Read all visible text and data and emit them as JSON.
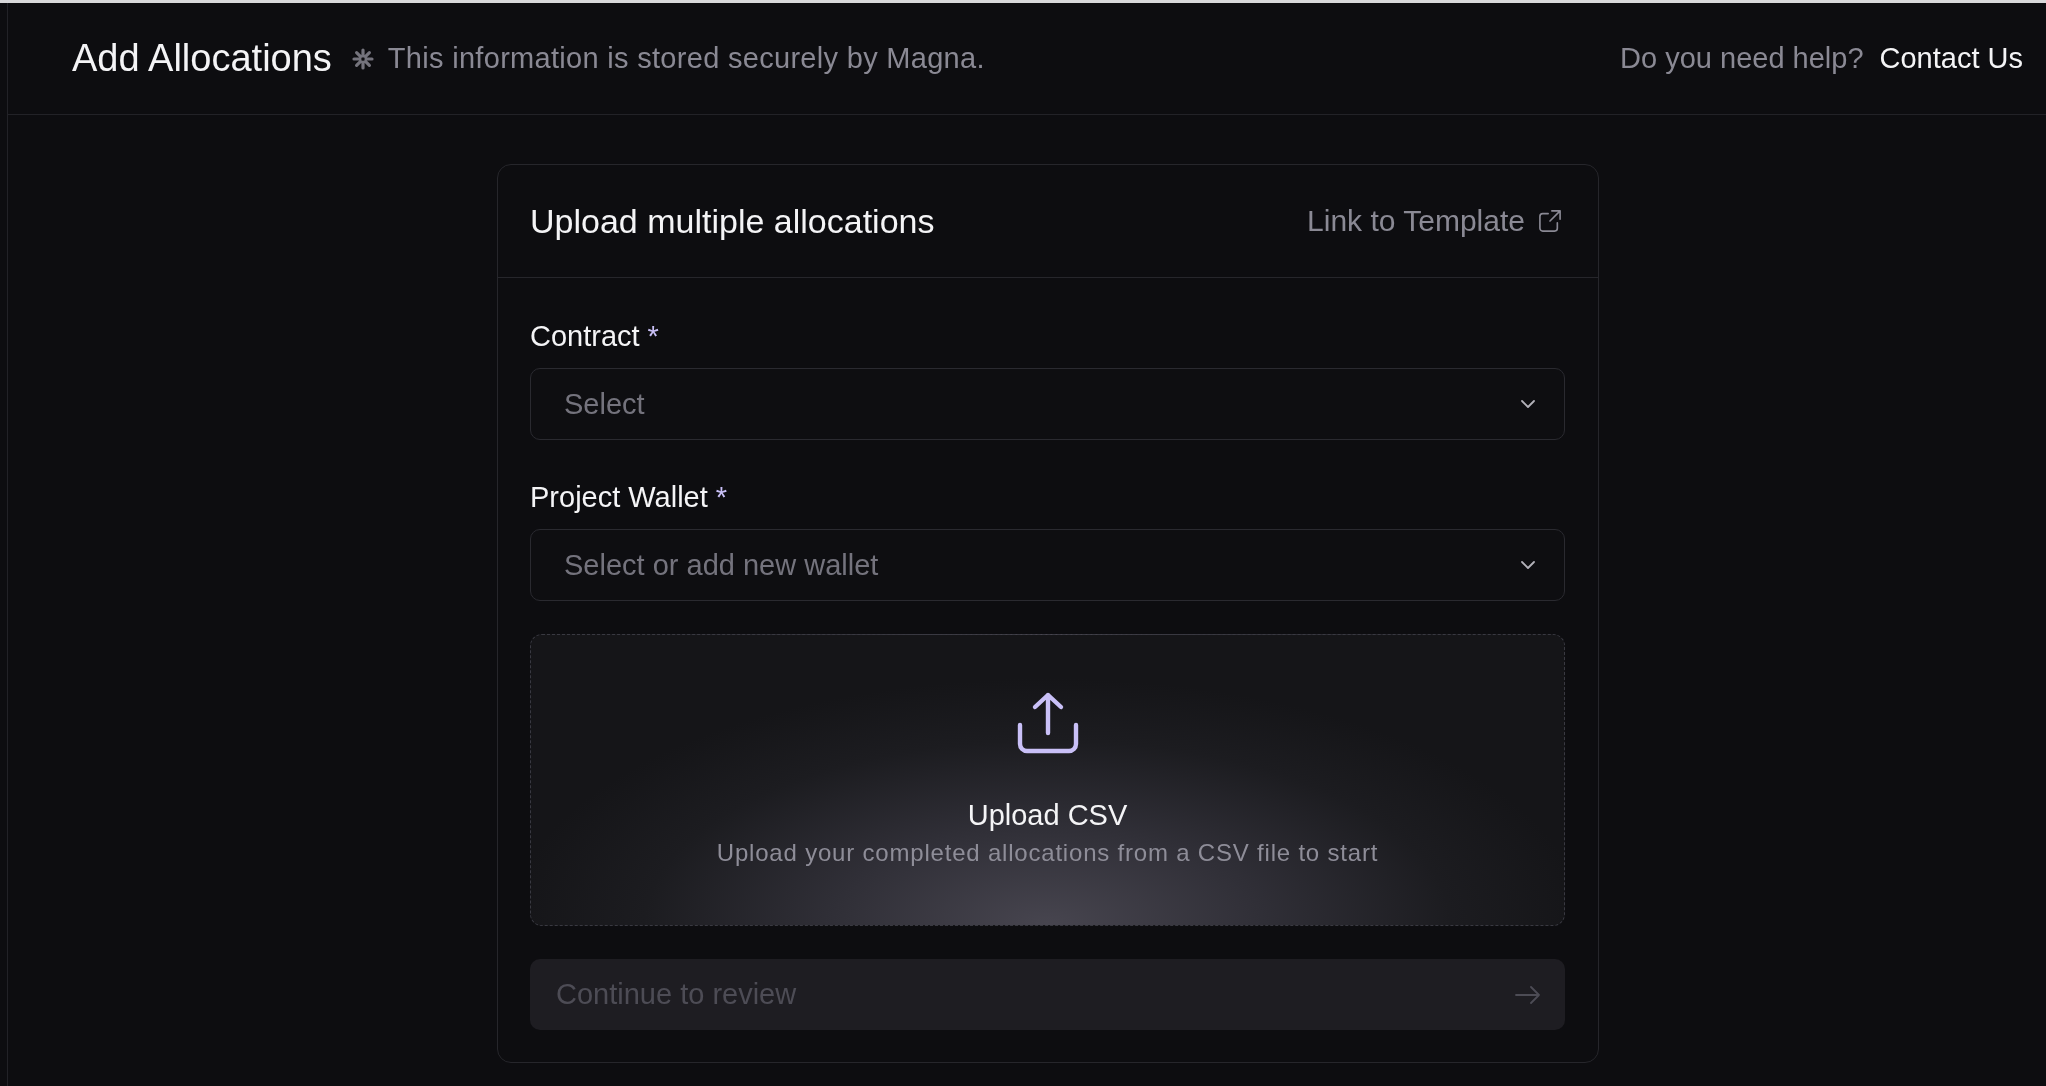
{
  "header": {
    "title": "Add Allocations",
    "subtitle": "This information is stored securely by Magna.",
    "help_text": "Do you need help?",
    "help_link": "Contact Us"
  },
  "card": {
    "title": "Upload multiple allocations",
    "template_link": "Link to Template",
    "fields": [
      {
        "label": "Contract",
        "required_mark": "*",
        "placeholder": "Select"
      },
      {
        "label": "Project Wallet",
        "required_mark": "*",
        "placeholder": "Select or add new wallet"
      }
    ],
    "upload": {
      "title": "Upload CSV",
      "description": "Upload your completed allocations from a CSV file to start"
    },
    "submit": {
      "label": "Continue to review",
      "disabled": true
    }
  }
}
